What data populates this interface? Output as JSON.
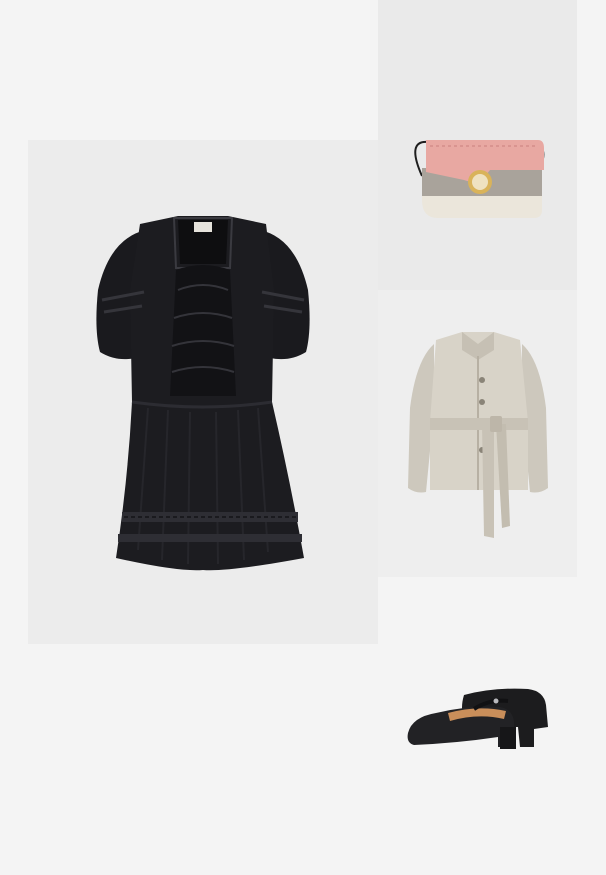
{
  "outfit": {
    "items": [
      {
        "name": "dress",
        "icon": "black-lace-mini-dress",
        "color": "#16161a"
      },
      {
        "name": "bag",
        "icon": "pink-cream-crossbody-bag",
        "color": "#e8a6a0"
      },
      {
        "name": "jacket",
        "icon": "beige-belted-jacket",
        "color": "#d8d3c8"
      },
      {
        "name": "shoes",
        "icon": "black-mary-jane-pumps",
        "color": "#1c1c1e"
      }
    ],
    "background": "#f4f4f4"
  }
}
